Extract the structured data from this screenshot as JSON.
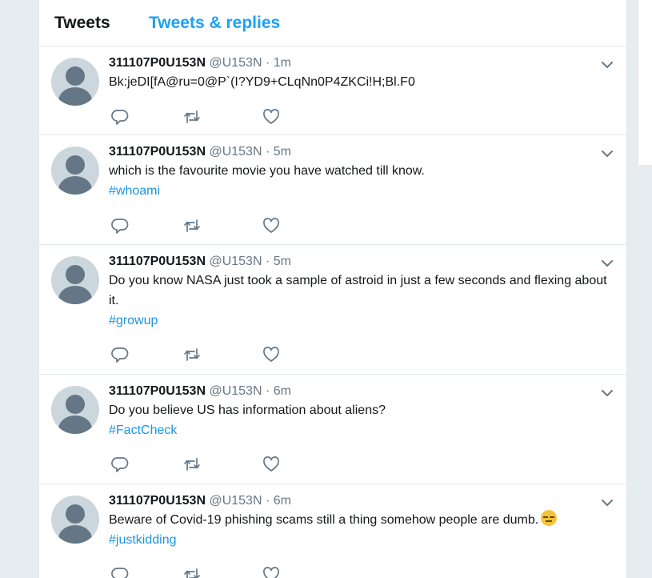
{
  "tabs": {
    "tweets": "Tweets",
    "tweets_replies": "Tweets & replies"
  },
  "colors": {
    "accent": "#1da1f2",
    "hashtag": "#1b95e0",
    "muted": "#657786",
    "text": "#14171a"
  },
  "tweets": [
    {
      "name": "311107P0U153N",
      "handle": "@U153N",
      "separator": "·",
      "time": "1m",
      "text": "Bk:jeDI[fA@ru=0@P`(I?YD9+CLqNn0P4ZKCi!H;Bl.F0",
      "hashtag": ""
    },
    {
      "name": "311107P0U153N",
      "handle": "@U153N",
      "separator": "·",
      "time": "5m",
      "text": "which is the favourite movie you have watched till know.",
      "hashtag": "#whoami"
    },
    {
      "name": "311107P0U153N",
      "handle": "@U153N",
      "separator": "·",
      "time": "5m",
      "text": "Do you know NASA just took a sample of astroid in just a few seconds and flexing about it.",
      "hashtag": "#growup"
    },
    {
      "name": "311107P0U153N",
      "handle": "@U153N",
      "separator": "·",
      "time": "6m",
      "text": "Do you believe US has information about aliens?",
      "hashtag": "#FactCheck"
    },
    {
      "name": "311107P0U153N",
      "handle": "@U153N",
      "separator": "·",
      "time": "6m",
      "text": "Beware of Covid-19 phishing scams still a thing somehow people are dumb.",
      "emoji": "expressionless-face-emoji",
      "hashtag": "#justkidding"
    }
  ]
}
